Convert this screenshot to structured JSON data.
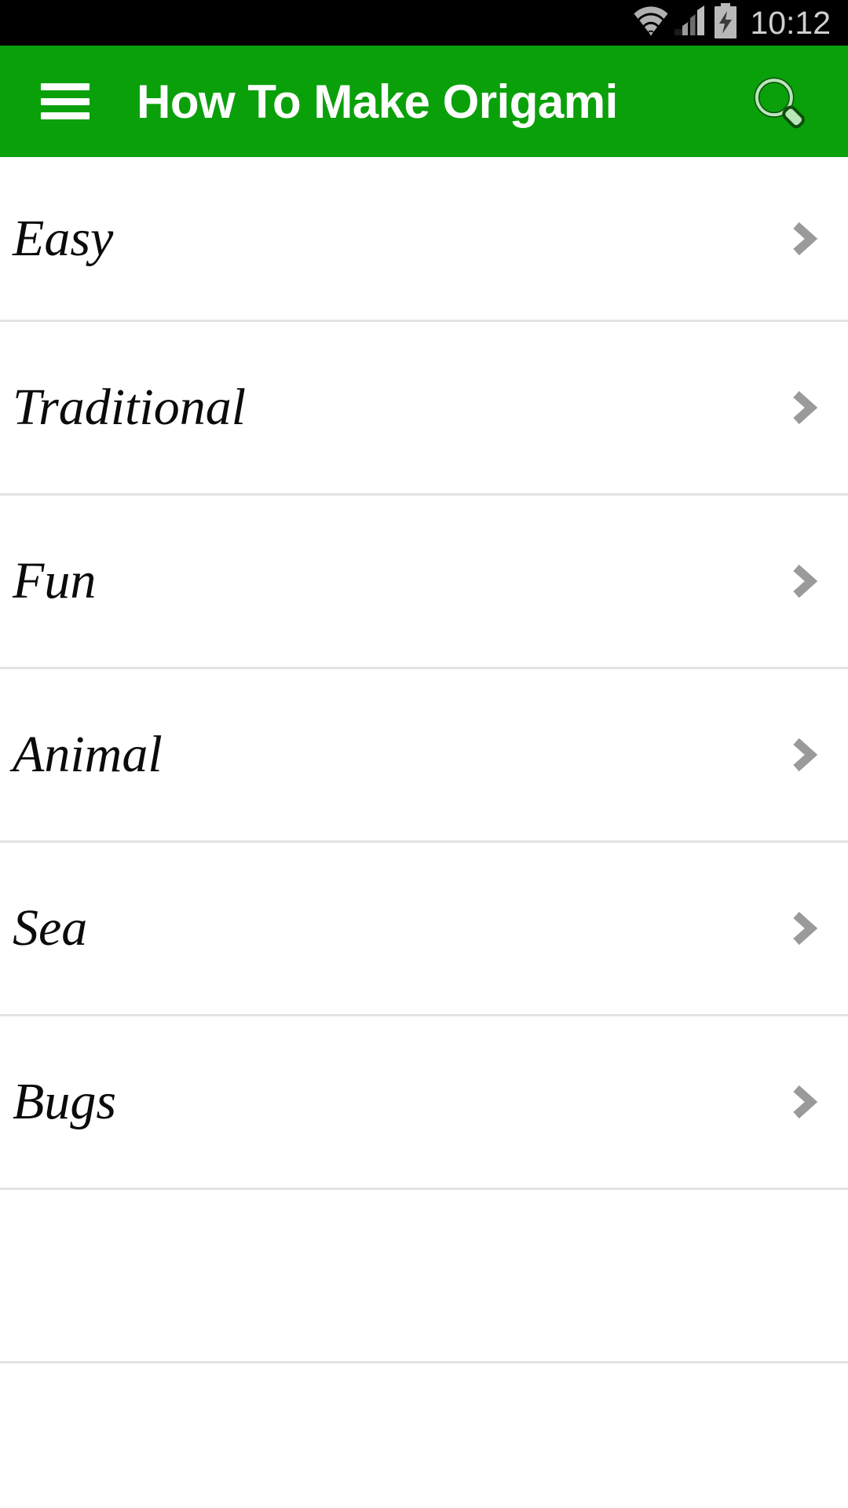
{
  "status_bar": {
    "time": "10:12",
    "icons": [
      {
        "name": "wifi-icon",
        "label": "wifi"
      },
      {
        "name": "cellular-signal-icon",
        "label": "signal"
      },
      {
        "name": "battery-charging-icon",
        "label": "battery charging"
      }
    ],
    "background_color": "#000000",
    "text_color": "#cfcfcf"
  },
  "app_bar": {
    "title": "How To Make Origami",
    "menu_icon": "hamburger-menu-icon",
    "search_icon": "search-icon",
    "background_color": "#0aa00a",
    "title_color": "#ffffff"
  },
  "list": {
    "divider_color": "#e3e3e3",
    "chevron_color": "#9a9a9a",
    "items": [
      {
        "label": "Easy",
        "chevron": "chevron-right-icon"
      },
      {
        "label": "Traditional",
        "chevron": "chevron-right-icon"
      },
      {
        "label": "Fun",
        "chevron": "chevron-right-icon"
      },
      {
        "label": "Animal",
        "chevron": "chevron-right-icon"
      },
      {
        "label": "Sea",
        "chevron": "chevron-right-icon"
      },
      {
        "label": "Bugs",
        "chevron": "chevron-right-icon"
      }
    ]
  }
}
